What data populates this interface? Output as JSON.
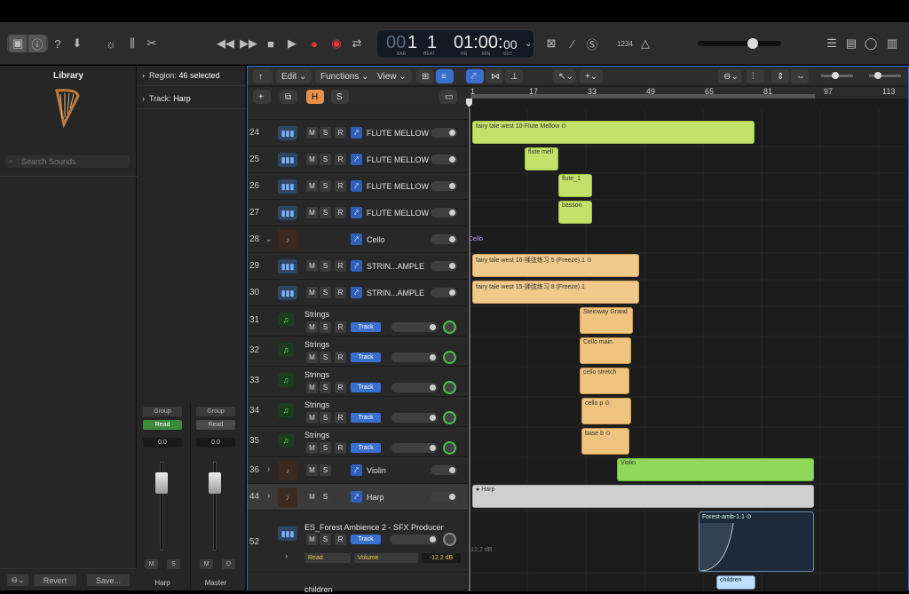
{
  "transport": {
    "bar": "1",
    "beat": "1",
    "time": "01:00:",
    "time_frames": "00",
    "label_bar": "BAR",
    "label_beat": "BEAT",
    "label_hr": "HR",
    "label_min": "MIN",
    "label_sec": "SEC",
    "key_sig": "1234"
  },
  "library": {
    "title": "Library",
    "search_placeholder": "Search Sounds",
    "revert_label": "Revert",
    "save_label": "Save..."
  },
  "inspector": {
    "region_label": "Region:",
    "region_value": "46 selected",
    "track_label": "Track:",
    "track_value": "Harp",
    "strips": [
      {
        "group": "Group",
        "mode": "Read",
        "value": "0.0",
        "m": "M",
        "s": "S",
        "name": "Harp"
      },
      {
        "group": "Group",
        "mode": "Read",
        "value": "0.0",
        "m": "M",
        "s": "D",
        "name": "Master"
      }
    ]
  },
  "tracks_toolbar": {
    "edit": "Edit",
    "functions": "Functions",
    "view": "View",
    "h": "H",
    "s": "S"
  },
  "ruler": [
    "1",
    "17",
    "33",
    "49",
    "65",
    "81",
    "97",
    "113"
  ],
  "tracks": [
    {
      "num": "24",
      "name": "FLUTE MELLOW"
    },
    {
      "num": "25",
      "name": "FLUTE MELLOW"
    },
    {
      "num": "26",
      "name": "FLUTE MELLOW"
    },
    {
      "num": "27",
      "name": "FLUTE MELLOW"
    },
    {
      "num": "28",
      "name": "Cello"
    },
    {
      "num": "29",
      "name": "STRIN...AMPLE"
    },
    {
      "num": "30",
      "name": "STRIN...AMPLE"
    },
    {
      "num": "31",
      "name": "Strings",
      "badge": "Track"
    },
    {
      "num": "32",
      "name": "Strings",
      "badge": "Track"
    },
    {
      "num": "33",
      "name": "Strings",
      "badge": "Track"
    },
    {
      "num": "34",
      "name": "Strings",
      "badge": "Track"
    },
    {
      "num": "35",
      "name": "Strings",
      "badge": "Track"
    },
    {
      "num": "36",
      "name": "Violin"
    },
    {
      "num": "44",
      "name": "Harp"
    },
    {
      "num": "52",
      "name": "ES_Forest Ambience 2 - SFX Producer",
      "badge": "Track",
      "auto_mode": "Read",
      "auto_param": "Volume",
      "auto_value": "-12.2 dB"
    },
    {
      "name": "children"
    }
  ],
  "msr": {
    "m": "M",
    "s": "S",
    "r": "R"
  },
  "regions": {
    "r1": "fairy tale west 10-Flute Mellow",
    "r2": "flute mell",
    "r3": "flute_1",
    "r4": "basson",
    "cello_label": "Cello",
    "r5": "fairy tale west 16-揉弦练习 5 (Freeze).1",
    "r6": "fairy tale west 15-揉弦练习 8 (Freeze).1",
    "r7": "Steinway Grand",
    "r8": "Cello main",
    "r9": "cello stretch",
    "r10": "cello p",
    "r11": "base b",
    "r12": "Violin",
    "r13": "Harp",
    "r14": "Forest-amb-1.1",
    "r15": "children",
    "auto_db": "-12.2 dB"
  }
}
